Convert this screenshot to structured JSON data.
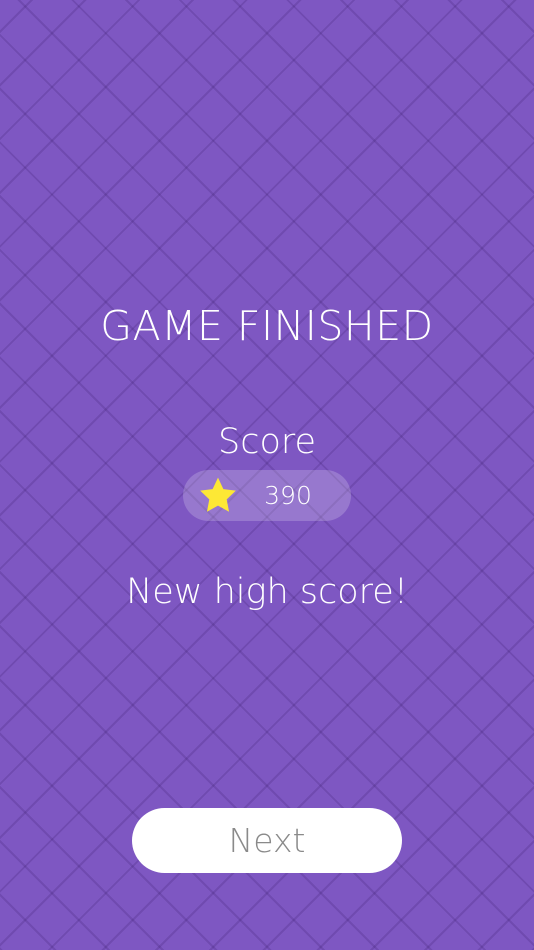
{
  "screen": {
    "title": "GAME FINISHED",
    "score_label": "Score",
    "score_icon": "star-icon",
    "score_value": "390",
    "message": "New high score!",
    "next_label": "Next"
  },
  "colors": {
    "background": "#7e57c2",
    "grid_lines": "#5f3a9a",
    "star": "#fde835",
    "pill": "rgba(255,255,255,0.2)",
    "button_bg": "#ffffff",
    "button_text": "#8a8a8a",
    "text": "#ffffff"
  }
}
